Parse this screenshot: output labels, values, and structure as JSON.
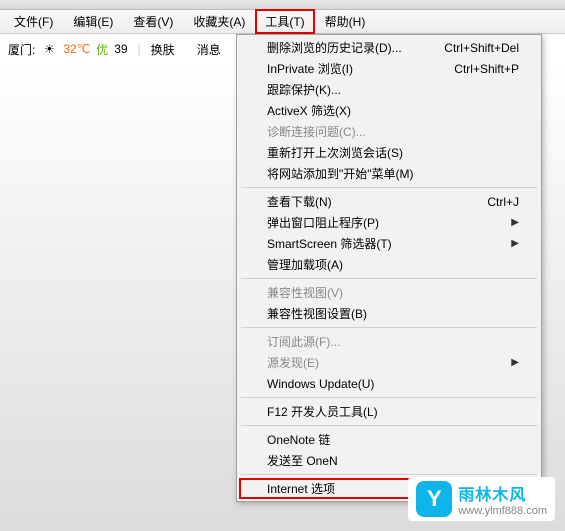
{
  "menubar": {
    "file": "文件(F)",
    "edit": "编辑(E)",
    "view": "查看(V)",
    "favorites": "收藏夹(A)",
    "tools": "工具(T)",
    "help": "帮助(H)"
  },
  "infobar": {
    "city": "厦门:",
    "weather_icon": "☀",
    "temp": "32℃",
    "quality_label": "优",
    "quality_value": "39",
    "huanfu": "换肤",
    "xiaoxi": "消息"
  },
  "dropdown": {
    "delete_history": "删除浏览的历史记录(D)...",
    "delete_history_sc": "Ctrl+Shift+Del",
    "inprivate": "InPrivate 浏览(I)",
    "inprivate_sc": "Ctrl+Shift+P",
    "tracking": "跟踪保护(K)...",
    "activex": "ActiveX 筛选(X)",
    "diagnose": "诊断连接问题(C)...",
    "reopen": "重新打开上次浏览会话(S)",
    "addstart": "将网站添加到\"开始\"菜单(M)",
    "downloads": "查看下载(N)",
    "downloads_sc": "Ctrl+J",
    "popup": "弹出窗口阻止程序(P)",
    "smartscreen": "SmartScreen 筛选器(T)",
    "addons": "管理加载项(A)",
    "compat_view": "兼容性视图(V)",
    "compat_settings": "兼容性视图设置(B)",
    "subscribe": "订阅此源(F)...",
    "feed_discovery": "源发现(E)",
    "windows_update": "Windows Update(U)",
    "f12": "F12 开发人员工具(L)",
    "onenote_link": "OneNote 链",
    "send_onenote": "发送至 OneN",
    "internet_options": "Internet 选项"
  },
  "watermark": {
    "logo_char": "Y",
    "title": "雨林木风",
    "url": "www.ylmf888.com"
  }
}
